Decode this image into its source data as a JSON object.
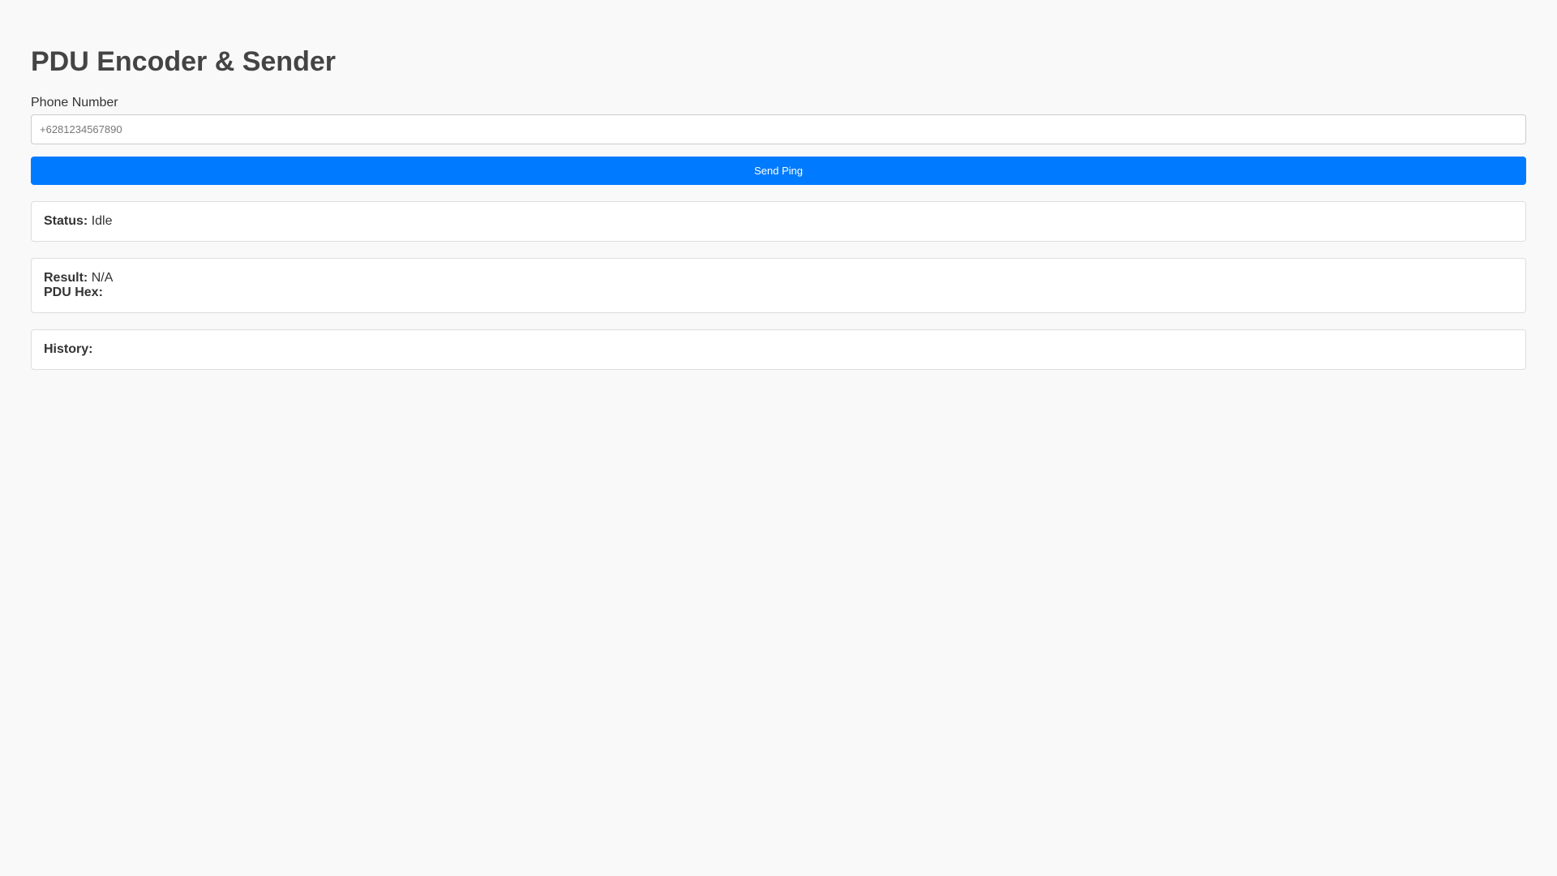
{
  "page": {
    "title": "PDU Encoder & Sender"
  },
  "form": {
    "phone_label": "Phone Number",
    "phone_placeholder": "+6281234567890",
    "phone_value": "",
    "send_label": "Send Ping"
  },
  "status": {
    "label": "Status:",
    "value": "Idle"
  },
  "result": {
    "label": "Result:",
    "value": "N/A",
    "pdu_label": "PDU Hex:",
    "pdu_value": ""
  },
  "history": {
    "label": "History:",
    "items": []
  },
  "colors": {
    "accent": "#007bff",
    "background": "#f9f9f9",
    "panel": "#ffffff"
  }
}
